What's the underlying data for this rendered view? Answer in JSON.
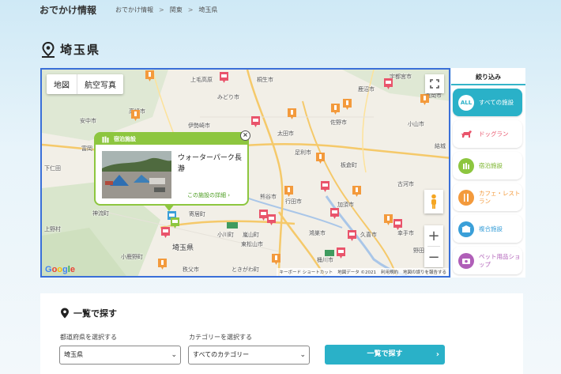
{
  "header": {
    "site_title": "おでかけ情報",
    "breadcrumb": [
      "おでかけ情報",
      "関東",
      "埼玉県"
    ],
    "breadcrumb_sep": ">"
  },
  "page": {
    "title": "埼玉県"
  },
  "map": {
    "type_buttons": [
      "地図",
      "航空写真"
    ],
    "google_logo": "Google",
    "attribution": [
      "キーボード ショートカット",
      "地図データ ©2021",
      "利用規約",
      "地図の誤りを報告する"
    ],
    "zoom_in": "+",
    "zoom_out": "−",
    "places": [
      {
        "name": "上毛高原",
        "big": false
      },
      {
        "name": "桐生市",
        "big": false
      },
      {
        "name": "みどり市",
        "big": false
      },
      {
        "name": "宇都宮市",
        "big": false
      },
      {
        "name": "鹿沼市",
        "big": false
      },
      {
        "name": "真岡市",
        "big": false
      },
      {
        "name": "高崎市",
        "big": false
      },
      {
        "name": "安中市",
        "big": false
      },
      {
        "name": "伊勢崎市",
        "big": false
      },
      {
        "name": "太田市",
        "big": false
      },
      {
        "name": "佐野市",
        "big": false
      },
      {
        "name": "小山市",
        "big": false
      },
      {
        "name": "結城",
        "big": false
      },
      {
        "name": "富岡",
        "big": false
      },
      {
        "name": "下仁田",
        "big": false
      },
      {
        "name": "足利市",
        "big": false
      },
      {
        "name": "板倉町",
        "big": false
      },
      {
        "name": "古河市",
        "big": false
      },
      {
        "name": "熊谷市",
        "big": false
      },
      {
        "name": "行田市",
        "big": false
      },
      {
        "name": "加須市",
        "big": false
      },
      {
        "name": "神流町",
        "big": false
      },
      {
        "name": "寄居町",
        "big": false
      },
      {
        "name": "上野村",
        "big": false
      },
      {
        "name": "小川町",
        "big": false
      },
      {
        "name": "嵐山町",
        "big": false
      },
      {
        "name": "鴻巣市",
        "big": false
      },
      {
        "name": "久喜市",
        "big": false
      },
      {
        "name": "幸手市",
        "big": false
      },
      {
        "name": "埼玉県",
        "big": true
      },
      {
        "name": "東松山市",
        "big": false
      },
      {
        "name": "小鹿野町",
        "big": false
      },
      {
        "name": "桶川市",
        "big": false
      },
      {
        "name": "秩父市",
        "big": false
      },
      {
        "name": "ときがわ町",
        "big": false
      },
      {
        "name": "野田市",
        "big": false
      }
    ],
    "popup": {
      "category": "宿泊施設",
      "name": "ウォーターパーク長瀞",
      "link": "この施設の詳細",
      "close": "×"
    }
  },
  "filter": {
    "title": "絞り込み",
    "items": [
      {
        "icon": "ALL",
        "label": "すべての施設",
        "color": "#2ab1c8"
      },
      {
        "icon": "",
        "label": "ドッグラン",
        "color": "#e9546b"
      },
      {
        "icon": "",
        "label": "宿泊施設",
        "color": "#8dc63f"
      },
      {
        "icon": "",
        "label": "カフェ・レストラン",
        "color": "#f39a3c"
      },
      {
        "icon": "",
        "label": "複合施設",
        "color": "#3a9fd8"
      },
      {
        "icon": "",
        "label": "ペット用品ショップ",
        "color": "#b05fb8"
      }
    ]
  },
  "search": {
    "title": "一覧で探す",
    "pref_label": "都道府県を選択する",
    "pref_value": "埼玉県",
    "cat_label": "カテゴリーを選択する",
    "cat_value": "すべてのカテゴリー",
    "button": "一覧で探す"
  }
}
